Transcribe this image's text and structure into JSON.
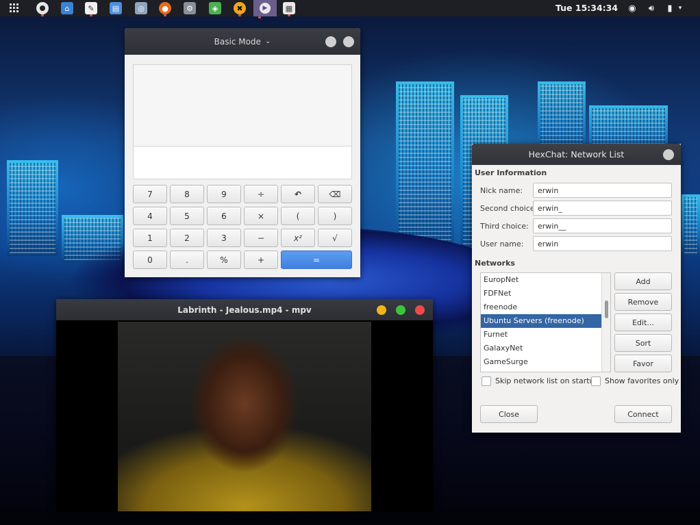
{
  "panel": {
    "clock": "Tue 15:34:34",
    "launchers": [
      {
        "icon": "apps-grid-icon"
      },
      {
        "icon": "screenshot-icon"
      },
      {
        "icon": "home-folder-icon"
      },
      {
        "icon": "text-editor-icon"
      },
      {
        "icon": "files-icon"
      },
      {
        "icon": "disk-icon"
      },
      {
        "icon": "firefox-icon"
      },
      {
        "icon": "system-settings-icon"
      },
      {
        "icon": "shield-icon"
      },
      {
        "icon": "hexchat-icon"
      },
      {
        "icon": "media-player-icon"
      },
      {
        "icon": "calculator-icon"
      }
    ],
    "tray": [
      {
        "icon": "network-icon"
      },
      {
        "icon": "volume-icon"
      },
      {
        "icon": "battery-icon"
      }
    ]
  },
  "calculator": {
    "mode_label": "Basic Mode",
    "buttons": {
      "b7": "7",
      "b8": "8",
      "b9": "9",
      "div": "÷",
      "undo": "↶",
      "back": "⌫",
      "b4": "4",
      "b5": "5",
      "b6": "6",
      "mul": "×",
      "lpar": "(",
      "rpar": ")",
      "b1": "1",
      "b2": "2",
      "b3": "3",
      "sub": "−",
      "pow": "x²",
      "sqrt": "√",
      "b0": "0",
      "dot": ".",
      "pct": "%",
      "add": "+",
      "eq": "="
    }
  },
  "mpv": {
    "title": "Labrinth - Jealous.mp4 - mpv"
  },
  "hexchat": {
    "title": "HexChat: Network List",
    "user_info_heading": "User Information",
    "fields": {
      "nick_label": "Nick name:",
      "nick_value": "erwin",
      "second_label": "Second choice:",
      "second_value": "erwin_",
      "third_label": "Third choice:",
      "third_value": "erwin__",
      "user_label": "User name:",
      "user_value": "erwin"
    },
    "networks_heading": "Networks",
    "networks": [
      "EuropNet",
      "FDFNet",
      "freenode",
      "Ubuntu Servers (freenode)",
      "Furnet",
      "GalaxyNet",
      "GameSurge"
    ],
    "selected_network": "Ubuntu Servers (freenode)",
    "buttons": {
      "add": "Add",
      "remove": "Remove",
      "edit": "Edit...",
      "sort": "Sort",
      "favor": "Favor",
      "close": "Close",
      "connect": "Connect"
    },
    "skip_label": "Skip network list on startup",
    "favorites_label": "Show favorites only"
  }
}
